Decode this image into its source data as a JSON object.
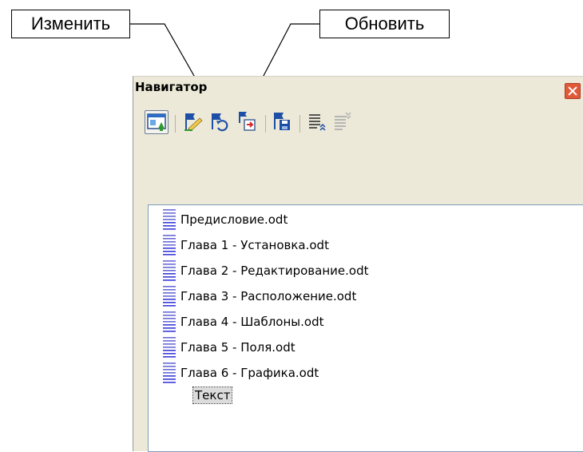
{
  "callouts": {
    "edit": "Изменить",
    "update": "Обновить"
  },
  "navigator": {
    "title": "Навигатор",
    "toolbar": [
      {
        "icon": "toggle-icon",
        "state": "pressed"
      },
      {
        "icon": "edit-icon"
      },
      {
        "icon": "update-icon"
      },
      {
        "icon": "insert-icon"
      },
      {
        "icon": "save-as-icon"
      },
      {
        "icon": "move-up-icon"
      },
      {
        "icon": "move-down-icon",
        "state": "disabled"
      }
    ],
    "documents": [
      "Предисловие.odt",
      "Глава 1 - Установка.odt",
      "Глава 2 - Редактирование.odt",
      "Глава 3 - Расположение.odt",
      "Глава 4 - Шаблоны.odt",
      "Глава 5 - Поля.odt",
      "Глава 6 - Графика.odt"
    ],
    "text_node": "Текст"
  },
  "colors": {
    "window_bg": "#ece9d8",
    "close_button": "#e05a3a",
    "doc_icon_lines": "#3a3ad8",
    "flag_green": "#2e9a2e",
    "flag_blue": "#1e4fa6"
  }
}
